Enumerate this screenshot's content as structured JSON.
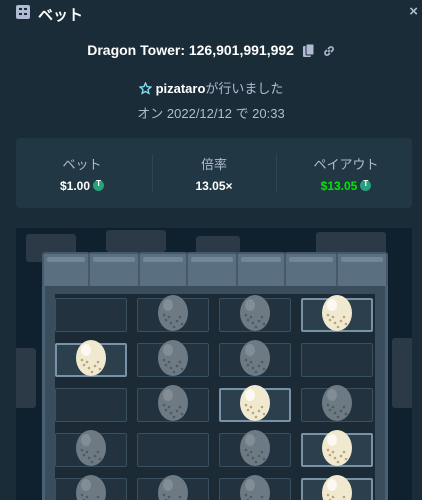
{
  "header": {
    "title": "ベット",
    "close": "×",
    "icon": "bet-receipt-icon"
  },
  "bet": {
    "game_title": "Dragon Tower: 126,901,991,992",
    "player_name": "pizataro",
    "player_suffix": "が行いました",
    "date": "オン 2022/12/12 で 20:33"
  },
  "stats": {
    "bet_label": "ベット",
    "bet_value": "$1.00",
    "multiplier_label": "倍率",
    "multiplier_value": "13.05×",
    "payout_label": "ペイアウト",
    "payout_value": "$13.05"
  },
  "colors": {
    "background": "#1a2c38",
    "panel": "#213743",
    "accent_green": "#00e701",
    "muted_text": "#b1bad3",
    "coin": "#26a17b"
  },
  "board": {
    "rows": [
      [
        "empty",
        "dragon",
        "dragon",
        "egg"
      ],
      [
        "egg",
        "dragon",
        "dragon",
        "empty"
      ],
      [
        "empty",
        "dragon",
        "egg",
        "dragon"
      ],
      [
        "dragon",
        "empty",
        "dragon",
        "egg"
      ],
      [
        "dragon",
        "dragon",
        "dragon",
        "egg"
      ]
    ],
    "selected": [
      [
        0,
        3
      ],
      [
        1,
        0
      ],
      [
        2,
        2
      ],
      [
        3,
        3
      ],
      [
        4,
        3
      ]
    ]
  }
}
